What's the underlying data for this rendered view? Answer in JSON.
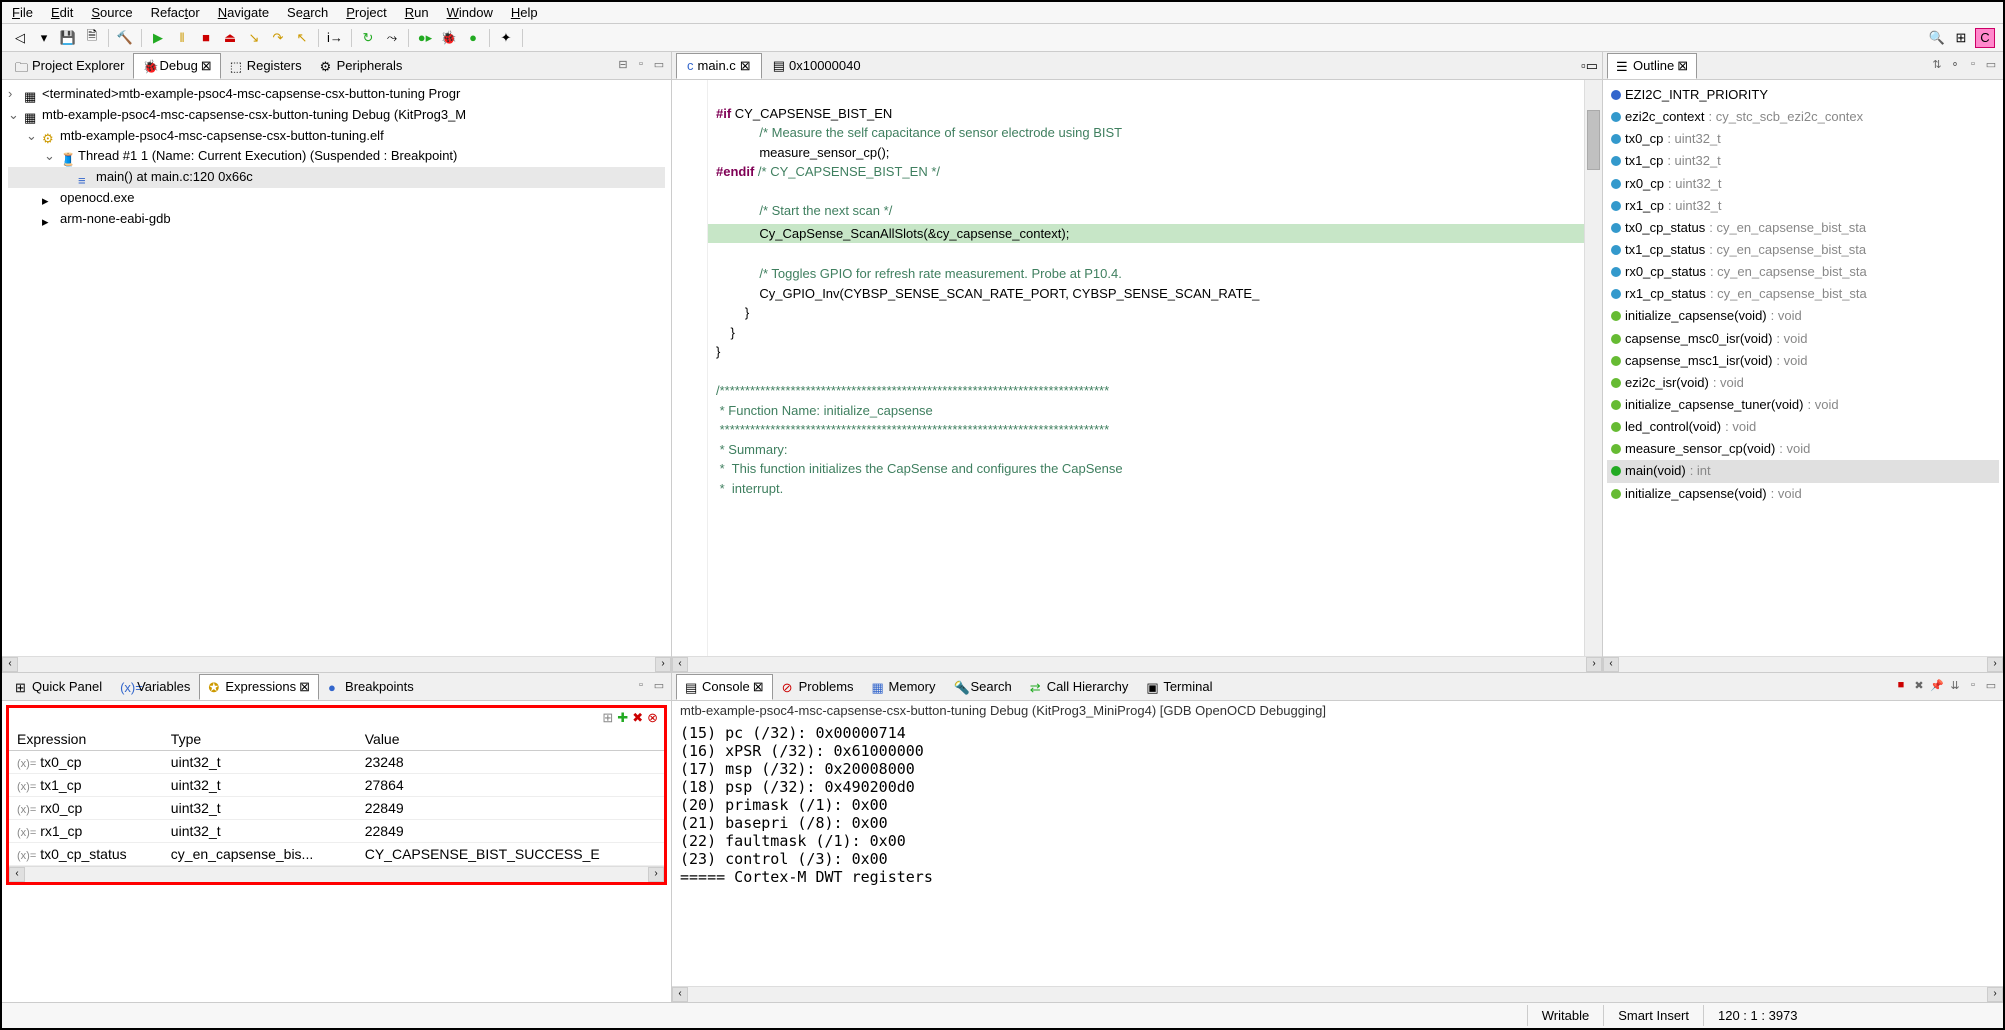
{
  "menu": {
    "file": "File",
    "edit": "Edit",
    "source": "Source",
    "refactor": "Refactor",
    "navigate": "Navigate",
    "search": "Search",
    "project": "Project",
    "run": "Run",
    "window": "Window",
    "help": "Help"
  },
  "views": {
    "project_explorer": "Project Explorer",
    "debug": "Debug",
    "registers": "Registers",
    "peripherals": "Peripherals",
    "quick_panel": "Quick Panel",
    "variables": "Variables",
    "expressions": "Expressions",
    "breakpoints": "Breakpoints",
    "outline": "Outline",
    "console": "Console",
    "problems": "Problems",
    "memory": "Memory",
    "search_view": "Search",
    "call_hierarchy": "Call Hierarchy",
    "terminal": "Terminal"
  },
  "debug_tree": {
    "launch_terminated": "<terminated>mtb-example-psoc4-msc-capsense-csx-button-tuning Progr",
    "launch": "mtb-example-psoc4-msc-capsense-csx-button-tuning Debug (KitProg3_M",
    "elf": "mtb-example-psoc4-msc-capsense-csx-button-tuning.elf",
    "thread": "Thread #1 1 (Name: Current Execution) (Suspended : Breakpoint)",
    "frame": "main() at main.c:120 0x66c",
    "proc1": "openocd.exe",
    "proc2": "arm-none-eabi-gdb"
  },
  "editor": {
    "tab1": "main.c",
    "tab2": "0x10000040",
    "lines": [
      "",
      "#if CY_CAPSENSE_BIST_EN",
      "            /* Measure the self capacitance of sensor electrode using BIST",
      "            measure_sensor_cp();",
      "#endif /* CY_CAPSENSE_BIST_EN */",
      "",
      "            /* Start the next scan */",
      "            Cy_CapSense_ScanAllSlots(&cy_capsense_context);",
      "",
      "            /* Toggles GPIO for refresh rate measurement. Probe at P10.4.",
      "            Cy_GPIO_Inv(CYBSP_SENSE_SCAN_RATE_PORT, CYBSP_SENSE_SCAN_RATE_",
      "        }",
      "    }",
      "}",
      "",
      "/*****************************************************************************",
      " * Function Name: initialize_capsense",
      " *****************************************************************************",
      " * Summary:",
      " *  This function initializes the CapSense and configures the CapSense",
      " *  interrupt."
    ]
  },
  "outline_items": [
    {
      "kind": "define",
      "name": "EZI2C_INTR_PRIORITY",
      "type": ""
    },
    {
      "kind": "var",
      "name": "ezi2c_context",
      "type": "cy_stc_scb_ezi2c_contex"
    },
    {
      "kind": "var",
      "name": "tx0_cp",
      "type": "uint32_t"
    },
    {
      "kind": "var",
      "name": "tx1_cp",
      "type": "uint32_t"
    },
    {
      "kind": "var",
      "name": "rx0_cp",
      "type": "uint32_t"
    },
    {
      "kind": "var",
      "name": "rx1_cp",
      "type": "uint32_t"
    },
    {
      "kind": "var",
      "name": "tx0_cp_status",
      "type": "cy_en_capsense_bist_sta"
    },
    {
      "kind": "var",
      "name": "tx1_cp_status",
      "type": "cy_en_capsense_bist_sta"
    },
    {
      "kind": "var",
      "name": "rx0_cp_status",
      "type": "cy_en_capsense_bist_sta"
    },
    {
      "kind": "var",
      "name": "rx1_cp_status",
      "type": "cy_en_capsense_bist_sta"
    },
    {
      "kind": "func",
      "name": "initialize_capsense(void)",
      "type": "void"
    },
    {
      "kind": "func",
      "name": "capsense_msc0_isr(void)",
      "type": "void"
    },
    {
      "kind": "func",
      "name": "capsense_msc1_isr(void)",
      "type": "void"
    },
    {
      "kind": "func",
      "name": "ezi2c_isr(void)",
      "type": "void"
    },
    {
      "kind": "func",
      "name": "initialize_capsense_tuner(void)",
      "type": "void"
    },
    {
      "kind": "func",
      "name": "led_control(void)",
      "type": "void"
    },
    {
      "kind": "func",
      "name": "measure_sensor_cp(void)",
      "type": "void"
    },
    {
      "kind": "main",
      "name": "main(void)",
      "type": "int",
      "active": true
    },
    {
      "kind": "func",
      "name": "initialize_capsense(void)",
      "type": "void"
    }
  ],
  "expressions": {
    "headers": {
      "expr": "Expression",
      "type": "Type",
      "value": "Value"
    },
    "rows": [
      {
        "expr": "tx0_cp",
        "type": "uint32_t",
        "value": "23248"
      },
      {
        "expr": "tx1_cp",
        "type": "uint32_t",
        "value": "27864"
      },
      {
        "expr": "rx0_cp",
        "type": "uint32_t",
        "value": "22849"
      },
      {
        "expr": "rx1_cp",
        "type": "uint32_t",
        "value": "22849"
      },
      {
        "expr": "tx0_cp_status",
        "type": "cy_en_capsense_bis...",
        "value": "CY_CAPSENSE_BIST_SUCCESS_E"
      }
    ]
  },
  "console_title": "mtb-example-psoc4-msc-capsense-csx-button-tuning Debug (KitProg3_MiniProg4) [GDB OpenOCD Debugging]",
  "console_lines": [
    "(15) pc (/32): 0x00000714",
    "(16) xPSR (/32): 0x61000000",
    "(17) msp (/32): 0x20008000",
    "(18) psp (/32): 0x490200d0",
    "(20) primask (/1): 0x00",
    "(21) basepri (/8): 0x00",
    "(22) faultmask (/1): 0x00",
    "(23) control (/3): 0x00",
    "===== Cortex-M DWT registers"
  ],
  "status": {
    "writable": "Writable",
    "insert": "Smart Insert",
    "pos": "120 : 1 : 3973"
  }
}
